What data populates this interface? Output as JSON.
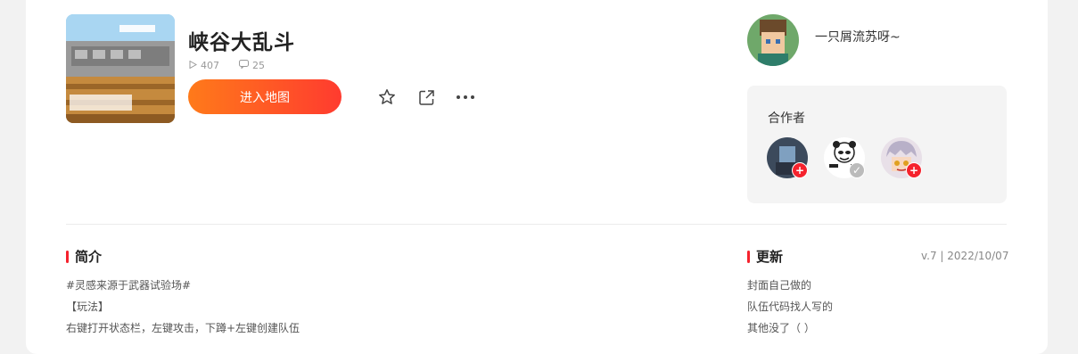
{
  "map": {
    "title": "峡谷大乱斗",
    "plays": "407",
    "comments": "25",
    "enter_label": "进入地图",
    "cover_icon": "minecraft-style-map-cover"
  },
  "actions": {
    "favorite_icon": "star-outline-icon",
    "share_icon": "external-share-icon",
    "more_icon": "more-dots-icon"
  },
  "author": {
    "name": "一只屑流苏呀~"
  },
  "collaborators": {
    "title": "合作者",
    "badge_colors": [
      "#f5222d",
      "#bbbbbb",
      "#f5222d"
    ]
  },
  "intro": {
    "title": "简介",
    "lines": [
      "#灵感来源于武器试验场#",
      "【玩法】",
      "右键打开状态栏，左键攻击，下蹲+左键创建队伍"
    ]
  },
  "update": {
    "title": "更新",
    "version": "v.7 | 2022/10/07",
    "lines": [
      "封面自己做的",
      "队伍代码找人写的",
      "其他没了（ ）"
    ]
  },
  "colors": {
    "accent": "#ff4a2a",
    "section_bar": "#f5222d"
  }
}
